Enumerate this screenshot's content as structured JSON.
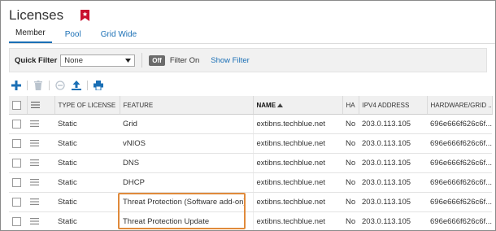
{
  "page": {
    "title": "Licenses"
  },
  "tabs": [
    {
      "label": "Member",
      "active": true
    },
    {
      "label": "Pool",
      "active": false
    },
    {
      "label": "Grid Wide",
      "active": false
    }
  ],
  "filter": {
    "label": "Quick Filter",
    "selected": "None",
    "toggle": "Off",
    "filter_on": "Filter On",
    "show_filter": "Show Filter"
  },
  "toolbar": {
    "icons": [
      "add-icon",
      "delete-icon",
      "clear-icon",
      "export-icon",
      "print-icon"
    ]
  },
  "table": {
    "columns": [
      "TYPE OF LICENSE",
      "FEATURE",
      "NAME",
      "HA",
      "IPV4 ADDRESS",
      "HARDWARE/GRID ..."
    ],
    "sort": {
      "column": "NAME",
      "direction": "ascending"
    },
    "rows": [
      {
        "type": "Static",
        "feature": "Grid",
        "name": "extibns.techblue.net",
        "ha": "No",
        "ipv4": "203.0.113.105",
        "hw": "696e666f626c6f..."
      },
      {
        "type": "Static",
        "feature": "vNIOS",
        "name": "extibns.techblue.net",
        "ha": "No",
        "ipv4": "203.0.113.105",
        "hw": "696e666f626c6f..."
      },
      {
        "type": "Static",
        "feature": "DNS",
        "name": "extibns.techblue.net",
        "ha": "No",
        "ipv4": "203.0.113.105",
        "hw": "696e666f626c6f..."
      },
      {
        "type": "Static",
        "feature": "DHCP",
        "name": "extibns.techblue.net",
        "ha": "No",
        "ipv4": "203.0.113.105",
        "hw": "696e666f626c6f..."
      },
      {
        "type": "Static",
        "feature": "Threat Protection (Software add-on)",
        "name": "extibns.techblue.net",
        "ha": "No",
        "ipv4": "203.0.113.105",
        "hw": "696e666f626c6f..."
      },
      {
        "type": "Static",
        "feature": "Threat Protection Update",
        "name": "extibns.techblue.net",
        "ha": "No",
        "ipv4": "203.0.113.105",
        "hw": "696e666f626c6f..."
      }
    ]
  },
  "colors": {
    "accent": "#1a6fb5",
    "highlight": "#e08a3b",
    "bookmark": "#c8102e"
  }
}
